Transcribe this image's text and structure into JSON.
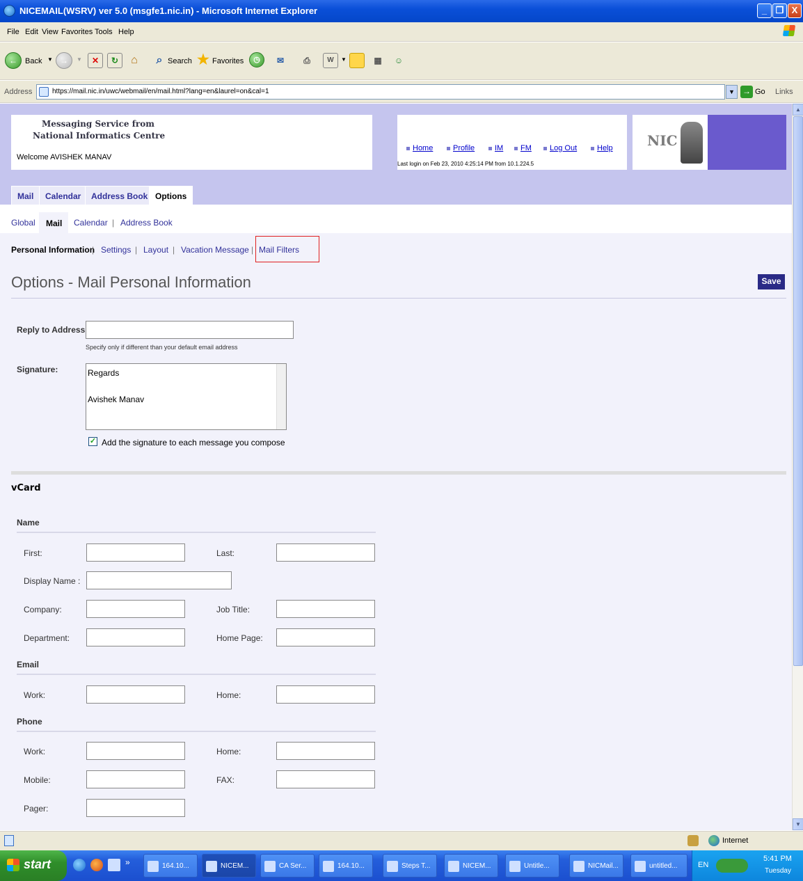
{
  "window": {
    "title": "NICEMAIL(WSRV) ver 5.0 (msgfe1.nic.in) - Microsoft Internet Explorer",
    "buttons": [
      "_",
      "❐",
      "X"
    ]
  },
  "menubar": [
    "File",
    "Edit",
    "View",
    "Favorites",
    "Tools",
    "Help"
  ],
  "toolbar": {
    "back": "Back",
    "search": "Search",
    "favorites": "Favorites"
  },
  "address": {
    "label": "Address",
    "url": "https://mail.nic.in/uwc/webmail/en/mail.html?lang=en&laurel=on&cal=1",
    "go": "Go",
    "links": "Links"
  },
  "header": {
    "brand_line1": "Messaging Service from",
    "brand_line2": "National Informatics Centre",
    "welcome": "Welcome AVISHEK MANAV",
    "links": [
      "Home",
      "Profile",
      "IM",
      "FM",
      "Log Out",
      "Help"
    ],
    "last_login": "Last login on Feb 23, 2010 4:25:14 PM from 10.1.224.5",
    "logo_text": "NIC"
  },
  "tabs": [
    "Mail",
    "Calendar",
    "Address Book",
    "Options"
  ],
  "subtabs": [
    "Global",
    "Mail",
    "Calendar",
    "Address Book"
  ],
  "mail_nav": [
    "Personal Information",
    "Settings",
    "Layout",
    "Vacation Message",
    "Mail Filters"
  ],
  "page_title": "Options - Mail Personal Information",
  "save_label": "Save",
  "form": {
    "reply_label": "Reply to Address:",
    "reply_value": "",
    "reply_hint": "Specify only if different than your default email address",
    "signature_label": "Signature:",
    "signature_line1": "Regards",
    "signature_line2": "Avishek Manav",
    "signature_checkbox": "Add the signature to each message you compose",
    "signature_checked": true
  },
  "vcard": {
    "title": "vCard",
    "name_section": "Name",
    "first": "First:",
    "last": "Last:",
    "display_name": "Display Name :",
    "company": "Company:",
    "job_title": "Job Title:",
    "department": "Department:",
    "home_page": "Home Page:",
    "email_section": "Email",
    "email_work": "Work:",
    "email_home": "Home:",
    "phone_section": "Phone",
    "phone_work": "Work:",
    "phone_home": "Home:",
    "mobile": "Mobile:",
    "fax": "FAX:",
    "pager": "Pager:"
  },
  "statusbar": {
    "zone": "Internet"
  },
  "taskbar": {
    "start": "start",
    "tasks": [
      "164.10...",
      "NICEM...",
      "CA Ser...",
      "164.10...",
      "Steps T...",
      "NICEM...",
      "Untitle...",
      "NICMail...",
      "untitled..."
    ],
    "lang": "EN",
    "time": "5:41 PM",
    "day": "Tuesday"
  }
}
